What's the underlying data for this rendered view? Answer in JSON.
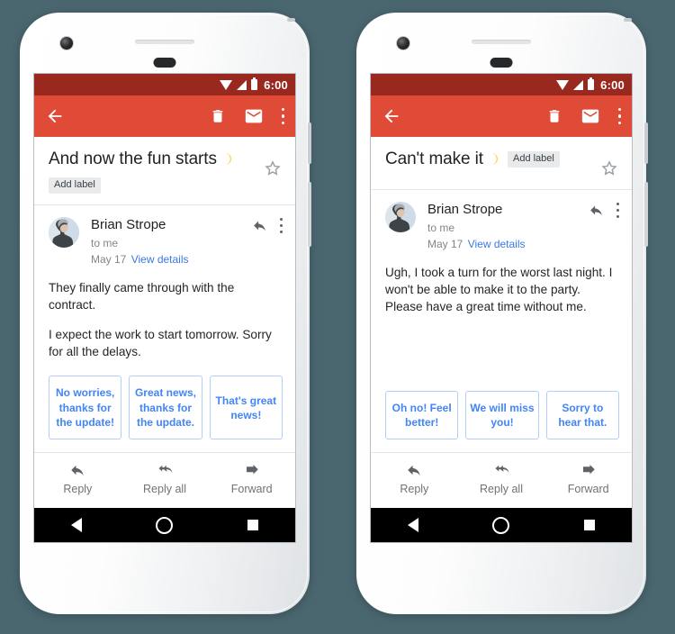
{
  "page": {
    "background_color": "#4a666f"
  },
  "theme": {
    "status_bar_color": "#99291f",
    "app_bar_color": "#e04b38",
    "chip_border_color": "#b4cefb",
    "chip_text_color": "#4285f4",
    "link_color": "#3b78e7",
    "label_chip_bg": "#e8eaec"
  },
  "phones": [
    {
      "id": "phone-left",
      "status_bar": {
        "time": "6:00",
        "icons": [
          "wifi-icon",
          "signal-icon",
          "battery-icon"
        ]
      },
      "app_bar": {
        "back_label": "Back",
        "actions": [
          "delete-icon",
          "mark-unread-icon",
          "overflow-menu-icon"
        ]
      },
      "subject": {
        "text": "And now the fun starts",
        "emoji": "crescent-moon",
        "label_chip": "Add label",
        "label_inline": false,
        "starred": false
      },
      "sender": {
        "name": "Brian Strope",
        "recipients": "to me",
        "date": "May 17",
        "details_link": "View details"
      },
      "body_paragraphs": [
        "They finally came through with the contract.",
        "I expect the work to start tomorrow. Sorry for all the delays."
      ],
      "smart_replies": [
        "No worries, thanks for the update!",
        "Great news, thanks for the update.",
        "That's great news!"
      ],
      "reply_bar": [
        {
          "label": "Reply",
          "icon": "reply-icon"
        },
        {
          "label": "Reply all",
          "icon": "reply-all-icon"
        },
        {
          "label": "Forward",
          "icon": "forward-icon"
        }
      ],
      "nav_bar": [
        "back-nav-icon",
        "home-nav-icon",
        "recents-nav-icon"
      ]
    },
    {
      "id": "phone-right",
      "status_bar": {
        "time": "6:00",
        "icons": [
          "wifi-icon",
          "signal-icon",
          "battery-icon"
        ]
      },
      "app_bar": {
        "back_label": "Back",
        "actions": [
          "delete-icon",
          "mark-unread-icon",
          "overflow-menu-icon"
        ]
      },
      "subject": {
        "text": "Can't make it",
        "emoji": "crescent-moon",
        "label_chip": "Add label",
        "label_inline": true,
        "starred": false
      },
      "sender": {
        "name": "Brian Strope",
        "recipients": "to me",
        "date": "May 17",
        "details_link": "View details"
      },
      "body_paragraphs": [
        "Ugh, I took a turn for the worst last night. I won't be able to make it to the party. Please have a great time without me."
      ],
      "smart_replies": [
        "Oh no! Feel better!",
        "We will miss you!",
        "Sorry to hear that."
      ],
      "reply_bar": [
        {
          "label": "Reply",
          "icon": "reply-icon"
        },
        {
          "label": "Reply all",
          "icon": "reply-all-icon"
        },
        {
          "label": "Forward",
          "icon": "forward-icon"
        }
      ],
      "nav_bar": [
        "back-nav-icon",
        "home-nav-icon",
        "recents-nav-icon"
      ]
    }
  ]
}
